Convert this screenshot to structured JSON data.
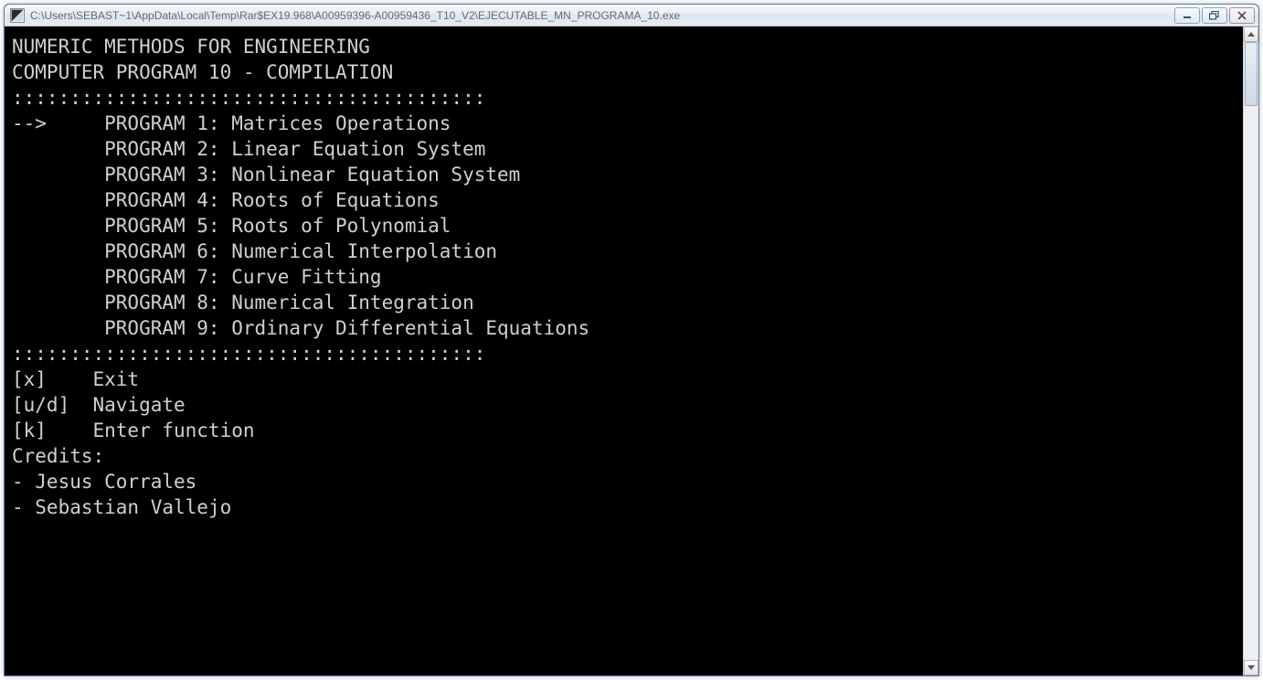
{
  "window": {
    "title_path": "C:\\Users\\SEBAST~1\\AppData\\Local\\Temp\\Rar$EX19.968\\A00959396-A00959436_T10_V2\\EJECUTABLE_MN_PROGRAMA_10.exe"
  },
  "console": {
    "header_line1": "NUMERIC METHODS FOR ENGINEERING",
    "header_line2": "COMPUTER PROGRAM 10 - COMPILATION",
    "separator": ":::::::::::::::::::::::::::::::::::::::::",
    "selected_index": 0,
    "arrow": "-->",
    "indent": "        ",
    "programs": [
      {
        "label": "PROGRAM 1",
        "name": "Matrices Operations"
      },
      {
        "label": "PROGRAM 2",
        "name": "Linear Equation System"
      },
      {
        "label": "PROGRAM 3",
        "name": "Nonlinear Equation System"
      },
      {
        "label": "PROGRAM 4",
        "name": "Roots of Equations"
      },
      {
        "label": "PROGRAM 5",
        "name": "Roots of Polynomial"
      },
      {
        "label": "PROGRAM 6",
        "name": "Numerical Interpolation"
      },
      {
        "label": "PROGRAM 7",
        "name": "Curve Fitting"
      },
      {
        "label": "PROGRAM 8",
        "name": "Numerical Integration"
      },
      {
        "label": "PROGRAM 9",
        "name": "Ordinary Differential Equations"
      }
    ],
    "controls": [
      {
        "key": "[x]",
        "pad": "    ",
        "action": "Exit"
      },
      {
        "key": "[u/d]",
        "pad": "  ",
        "action": "Navigate"
      },
      {
        "key": "[k]",
        "pad": "    ",
        "action": "Enter function"
      }
    ],
    "credits_title": "Credits:",
    "credits": [
      "- Jesus Corrales",
      "- Sebastian Vallejo"
    ]
  }
}
